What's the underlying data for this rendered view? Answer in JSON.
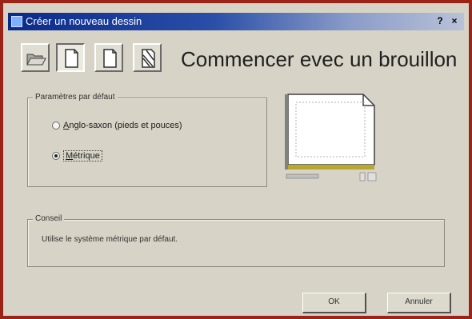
{
  "window": {
    "title": "Créer un nouveau dessin",
    "help_label": "?",
    "close_label": "×"
  },
  "toolbar": {
    "buttons": [
      {
        "name": "open-drawing",
        "icon": "folder-open-icon"
      },
      {
        "name": "start-from-scratch",
        "icon": "blank-page-icon",
        "pressed": true
      },
      {
        "name": "use-template",
        "icon": "template-page-icon"
      },
      {
        "name": "use-wizard",
        "icon": "wizard-icon"
      }
    ]
  },
  "heading": "Commencer evec un brouillon",
  "defaults_group": {
    "legend": "Paramètres par défaut",
    "options": [
      {
        "label": "Anglo-saxon (pieds et pouces)",
        "checked": false
      },
      {
        "label": "Métrique",
        "checked": true
      }
    ]
  },
  "description_group": {
    "legend": "Conseil",
    "text": "Utilise le système métrique par défaut."
  },
  "buttons": {
    "ok": "OK",
    "cancel": "Annuler"
  },
  "colors": {
    "frame": "#9a2418",
    "dialog_bg": "#d7d3c6",
    "titlebar_start": "#0a2a8a",
    "titlebar_end": "#b8c2d8"
  }
}
